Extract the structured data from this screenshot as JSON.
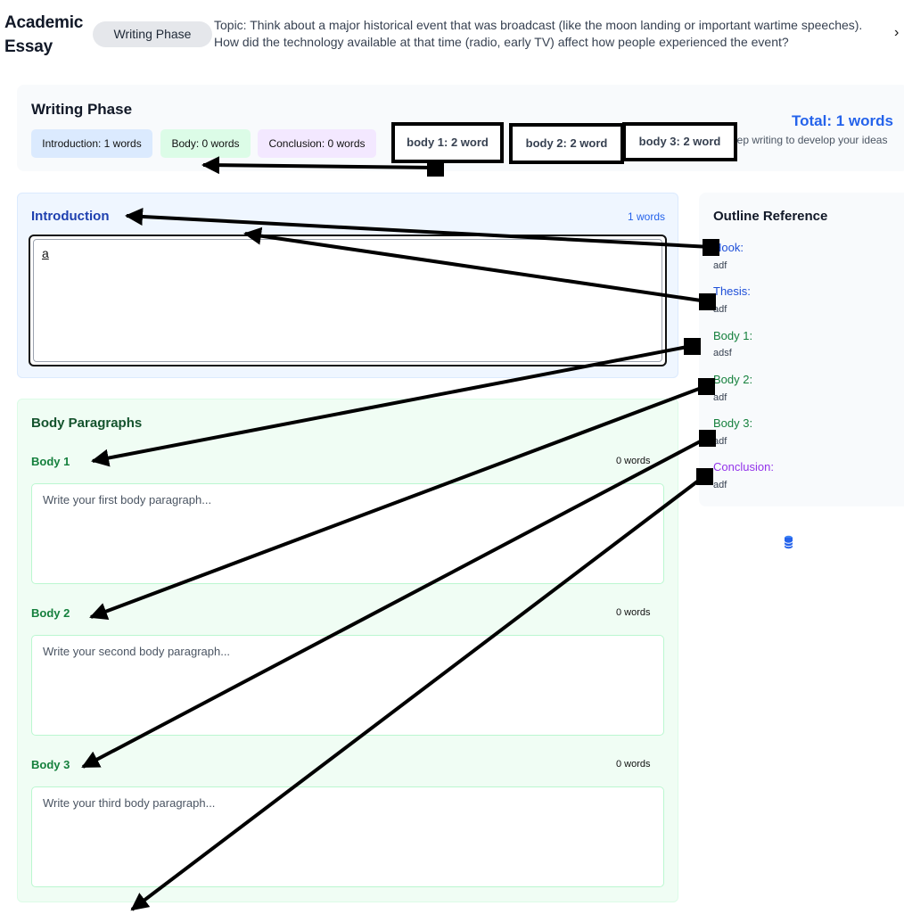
{
  "header": {
    "app_title": "Academic Essay",
    "phase_label": "Writing Phase",
    "topic": "Topic: Think about a major historical event that was broadcast (like the moon landing or important wartime speeches). How did the technology available at that time (radio, early TV) affect how people experienced the event?"
  },
  "summary": {
    "title": "Writing Phase",
    "intro_count": "Introduction: 1 words",
    "body_count": "Body: 0 words",
    "conclusion_count": "Conclusion: 0 words",
    "total": "Total: 1 words",
    "keep_writing": "eep writing to develop your ideas"
  },
  "callouts": {
    "body1": "body 1: 2 word",
    "body2": "body 2: 2 word",
    "body3": "body 3: 2 word"
  },
  "introduction": {
    "title": "Introduction",
    "count": "1 words",
    "text": "a"
  },
  "body": {
    "title": "Body Paragraphs",
    "paragraphs": [
      {
        "label": "Body 1",
        "count": "0 words",
        "placeholder": "Write your first body paragraph..."
      },
      {
        "label": "Body 2",
        "count": "0 words",
        "placeholder": "Write your second body paragraph..."
      },
      {
        "label": "Body 3",
        "count": "0 words",
        "placeholder": "Write your third body paragraph..."
      }
    ]
  },
  "outline": {
    "title": "Outline Reference",
    "items": [
      {
        "label": "Hook:",
        "value": "adf"
      },
      {
        "label": "Thesis:",
        "value": "adf"
      },
      {
        "label": "Body 1:",
        "value": "adsf"
      },
      {
        "label": "Body 2:",
        "value": "adf"
      },
      {
        "label": "Body 3:",
        "value": "adf"
      },
      {
        "label": "Conclusion:",
        "value": "adf"
      }
    ]
  },
  "icons": {
    "chevron": "chevron-right-icon",
    "database": "database-icon"
  },
  "colors": {
    "accent": "#2563eb",
    "body_green": "#15803d",
    "conclusion_purple": "#9333ea",
    "annotation": "#000000"
  }
}
